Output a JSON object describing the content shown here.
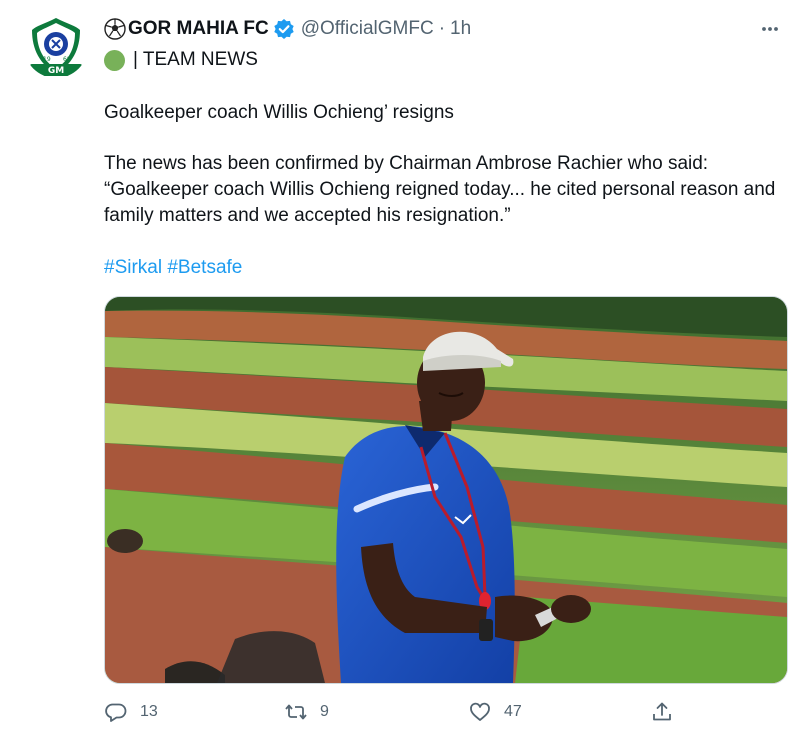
{
  "tweet": {
    "display_name": "GOR MAHIA FC",
    "handle": "@OfficialGMFC",
    "separator": "·",
    "time": "1h",
    "subhead": "| TEAM NEWS",
    "paragraphs": [
      "Goalkeeper coach Willis Ochieng’ resigns",
      "The news has been confirmed by Chairman Ambrose Rachier who said: “Goalkeeper coach Willis Ochieng reigned today... he cited personal reason and family matters and we accepted his resignation.”"
    ],
    "hashtags": [
      "#Sirkal",
      "#Betsafe"
    ],
    "logo": {
      "year_left": "19",
      "year_right": "68",
      "text": "GM",
      "banner": "GOR MAHIA"
    },
    "image_alt": "Goalkeeper coach in blue training shirt and white cap on a grass field"
  },
  "actions": {
    "reply_count": "13",
    "retweet_count": "9",
    "like_count": "47"
  },
  "icons": {
    "ball": "soccer-ball-icon",
    "verified": "verified-badge-icon",
    "more": "more-icon",
    "green_circle": "green-circle-icon",
    "reply": "reply-icon",
    "retweet": "retweet-icon",
    "like": "heart-icon",
    "share": "share-icon"
  },
  "colors": {
    "accent": "#1d9bf0",
    "secondary_text": "#536471",
    "club_green": "#0d7a3c",
    "emoji_green": "#78b159"
  }
}
